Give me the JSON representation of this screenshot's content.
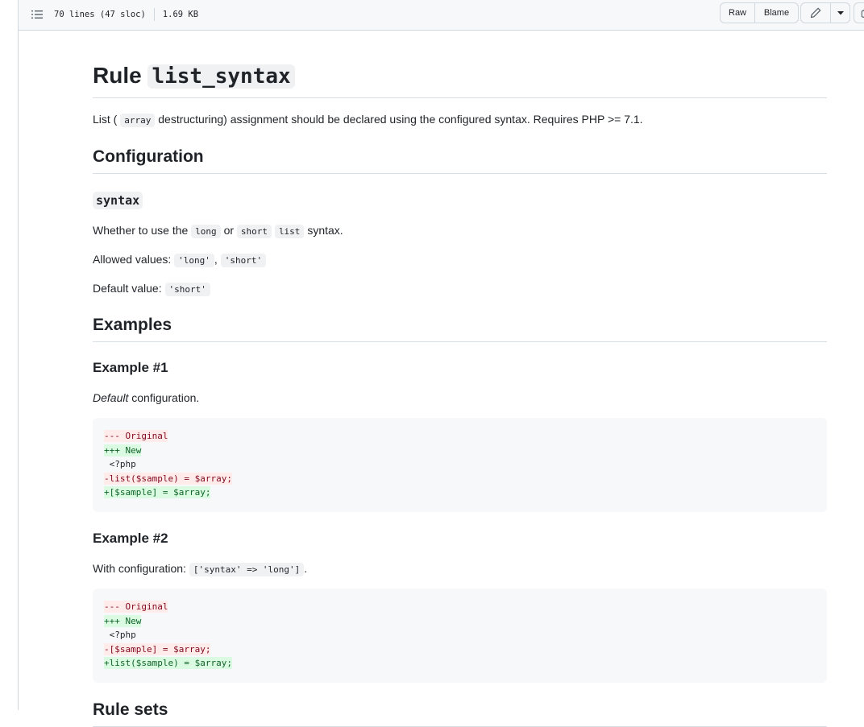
{
  "file_header": {
    "lines_info": "70 lines (47 sloc)",
    "size": "1.69 KB",
    "raw_label": "Raw",
    "blame_label": "Blame",
    "icons": [
      "toc-icon",
      "pencil-icon",
      "triangle-down-icon",
      "copy-icon"
    ]
  },
  "doc": {
    "title_prefix": "Rule",
    "title_code": "list_syntax",
    "intro_a": "List (",
    "intro_code": "array",
    "intro_b": "destructuring) assignment should be declared using the configured syntax. Requires PHP >= 7.1.",
    "config_heading": "Configuration",
    "option_name": "syntax",
    "option_desc_a": "Whether to use the",
    "option_desc_long": "long",
    "option_desc_or": "or",
    "option_desc_short": "short",
    "option_desc_list": "list",
    "option_desc_b": "syntax.",
    "allowed_label": "Allowed values:",
    "allowed_1": "'long'",
    "allowed_sep": ",",
    "allowed_2": "'short'",
    "default_label": "Default value:",
    "default_value": "'short'",
    "examples_heading": "Examples",
    "example1": {
      "heading": "Example #1",
      "desc_em": "Default",
      "desc_rest": "configuration.",
      "code": [
        "--- Original",
        "+++ New",
        " <?php",
        "-list($sample) = $array;",
        "+[$sample] = $array;"
      ]
    },
    "example2": {
      "heading": "Example #2",
      "desc": "With configuration:",
      "desc_code": "['syntax' => 'long']",
      "desc_end": ".",
      "code": [
        "--- Original",
        "+++ New",
        " <?php",
        "-[$sample] = $array;",
        "+list($sample) = $array;"
      ]
    },
    "next_heading": "Rule sets"
  }
}
